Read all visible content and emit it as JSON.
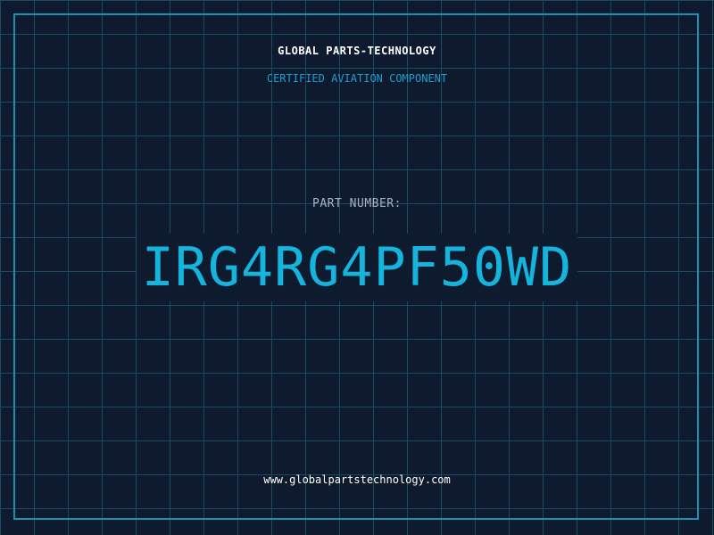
{
  "header": {
    "company": "GLOBAL PARTS-TECHNOLOGY",
    "tagline": "CERTIFIED AVIATION COMPONENT"
  },
  "part": {
    "label": "PART NUMBER:",
    "number": "IRG4RG4PF50WD"
  },
  "footer": {
    "website": "www.globalpartstechnology.com"
  },
  "colors": {
    "background": "#0e1a2e",
    "grid": "#1d4a63",
    "frame": "#1e8fb3",
    "accent": "#14b4dc",
    "tagline": "#1e9ed0",
    "label": "#aab4c2",
    "text": "#ffffff"
  }
}
